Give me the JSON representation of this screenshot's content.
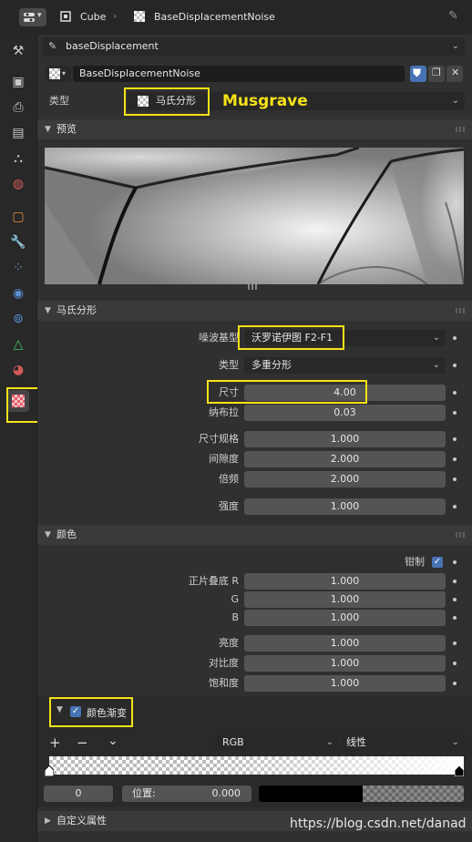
{
  "header": {
    "object_name": "Cube",
    "texture_name": "BaseDisplacementNoise"
  },
  "texture_slot": {
    "selected": "baseDisplacement",
    "datablock_name": "BaseDisplacementNoise"
  },
  "type_row": {
    "label": "类型",
    "value": "马氏分形",
    "annotation": "Musgrave"
  },
  "preview_panel": {
    "title": "预览"
  },
  "musgrave_panel": {
    "title": "马氏分形",
    "noise_basis_label": "噪波基型",
    "noise_basis_value": "沃罗诺伊图 F2-F1",
    "type_label": "类型",
    "type_value": "多重分形",
    "size_label": "尺寸",
    "size_value": "4.00",
    "nabla_label": "纳布拉",
    "nabla_value": "0.03",
    "dimension_label": "尺寸规格",
    "dimension_value": "1.000",
    "lacunarity_label": "间隙度",
    "lacunarity_value": "2.000",
    "octaves_label": "倍频",
    "octaves_value": "2.000",
    "intensity_label": "强度",
    "intensity_value": "1.000"
  },
  "colors_panel": {
    "title": "颜色",
    "clamp_label": "钳制",
    "clamp_checked": true,
    "multiply_r_label": "正片叠底 R",
    "multiply_r_value": "1.000",
    "g_label": "G",
    "g_value": "1.000",
    "b_label": "B",
    "b_value": "1.000",
    "brightness_label": "亮度",
    "brightness_value": "1.000",
    "contrast_label": "对比度",
    "contrast_value": "1.000",
    "saturation_label": "饱和度",
    "saturation_value": "1.000"
  },
  "color_ramp": {
    "title": "颜色渐变",
    "checked": true,
    "add_symbol": "+",
    "remove_symbol": "−",
    "menu_symbol": "⌄",
    "color_mode": "RGB",
    "interpolation": "线性",
    "active_index": "0",
    "position_label": "位置:",
    "position_value": "0.000"
  },
  "custom_props_panel": {
    "title": "自定义属性"
  },
  "watermark": "https://blog.csdn.net/danad",
  "colors": {
    "highlight": "#f5e218",
    "accent": "#4772b3",
    "panel_bg": "#303030"
  }
}
